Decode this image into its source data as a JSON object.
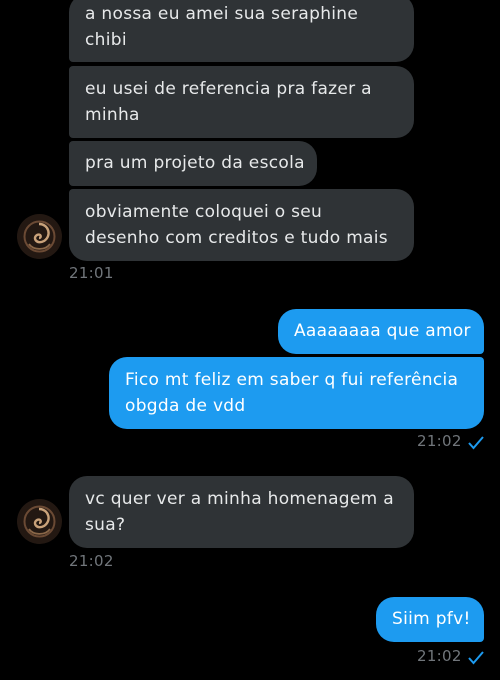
{
  "conversation": {
    "messages": [
      {
        "direction": "incoming",
        "lines": [
          "a nossa eu amei sua seraphine",
          "chibi"
        ]
      },
      {
        "direction": "incoming",
        "lines": [
          "eu usei de referencia pra fazer a",
          "minha"
        ]
      },
      {
        "direction": "incoming",
        "lines": [
          "pra um projeto da escola"
        ]
      },
      {
        "direction": "incoming",
        "lines": [
          "obviamente coloquei o seu",
          "desenho com creditos e tudo mais"
        ]
      },
      {
        "direction": "outgoing",
        "lines": [
          "Aaaaaaaa que amor"
        ]
      },
      {
        "direction": "outgoing",
        "lines": [
          "Fico mt feliz em saber q fui referência",
          "obgda de vdd"
        ]
      },
      {
        "direction": "incoming",
        "lines": [
          "vc quer ver a minha homenagem a",
          "sua?"
        ]
      },
      {
        "direction": "outgoing",
        "lines": [
          "Siim pfv!"
        ]
      }
    ],
    "timestamps": [
      "21:01",
      "21:02",
      "21:02",
      "21:02"
    ]
  },
  "colors": {
    "incoming_bubble": "#2f3336",
    "outgoing_bubble": "#1d9bf0",
    "background": "#000000",
    "read_check": "#1d9bf0"
  },
  "icons": {
    "avatar": "contact-avatar",
    "read_receipt": "checkmark-icon"
  }
}
